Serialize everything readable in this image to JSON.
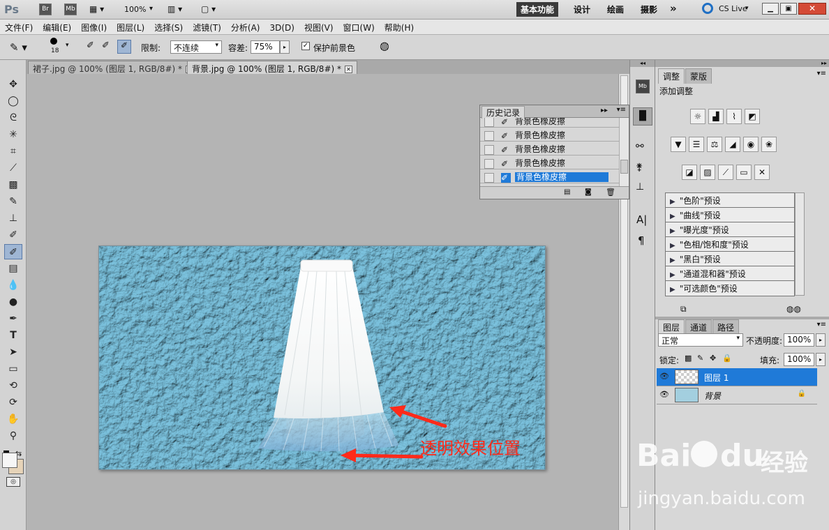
{
  "app": {
    "logo": "Ps",
    "zoom": "100%"
  },
  "header": {
    "app_icons": [
      "Br",
      "Mb"
    ],
    "workspaces": [
      "基本功能",
      "设计",
      "绘画",
      "摄影"
    ],
    "more": "»",
    "cs_live": "CS Live"
  },
  "menu": [
    "文件(F)",
    "编辑(E)",
    "图像(I)",
    "图层(L)",
    "选择(S)",
    "滤镜(T)",
    "分析(A)",
    "3D(D)",
    "视图(V)",
    "窗口(W)",
    "帮助(H)"
  ],
  "options": {
    "brush_size": "18",
    "limit_label": "限制:",
    "limit_value": "不连续",
    "tolerance_label": "容差:",
    "tolerance_value": "75%",
    "protect_label": "保护前景色"
  },
  "tabs": [
    {
      "label": "裙子.jpg @ 100% (图层 1, RGB/8#) *"
    },
    {
      "label": "背景.jpg @ 100% (图层 1, RGB/8#) *"
    }
  ],
  "history": {
    "title": "历史记录",
    "items": [
      "背景色橡皮擦",
      "背景色橡皮擦",
      "背景色橡皮擦",
      "背景色橡皮擦",
      "背景色橡皮擦"
    ],
    "selected_index": 4
  },
  "annotation": {
    "text": "透明效果位置",
    "color": "#ff2a1a"
  },
  "adjustments": {
    "tabs": [
      "调整",
      "蒙版"
    ],
    "title": "添加调整",
    "presets": [
      "\"色阶\"预设",
      "\"曲线\"预设",
      "\"曝光度\"预设",
      "\"色相/饱和度\"预设",
      "\"黑白\"预设",
      "\"通道混和器\"预设",
      "\"可选颜色\"预设"
    ]
  },
  "layers": {
    "tabs": [
      "图层",
      "通道",
      "路径"
    ],
    "blend_mode": "正常",
    "opacity_label": "不透明度:",
    "opacity_value": "100%",
    "lock_label": "锁定:",
    "fill_label": "填充:",
    "fill_value": "100%",
    "items": [
      {
        "name": "图层 1",
        "selected": true
      },
      {
        "name": "背景",
        "selected": false
      }
    ]
  },
  "watermark": {
    "brand": "Bai",
    "paw": "du",
    "site_cn": "经验",
    "url": "jingyan.baidu.com"
  },
  "colors": {
    "selection": "#1f7ad8",
    "accent_red": "#ff2a1a",
    "canvas_blue": "#a3cfdf"
  }
}
